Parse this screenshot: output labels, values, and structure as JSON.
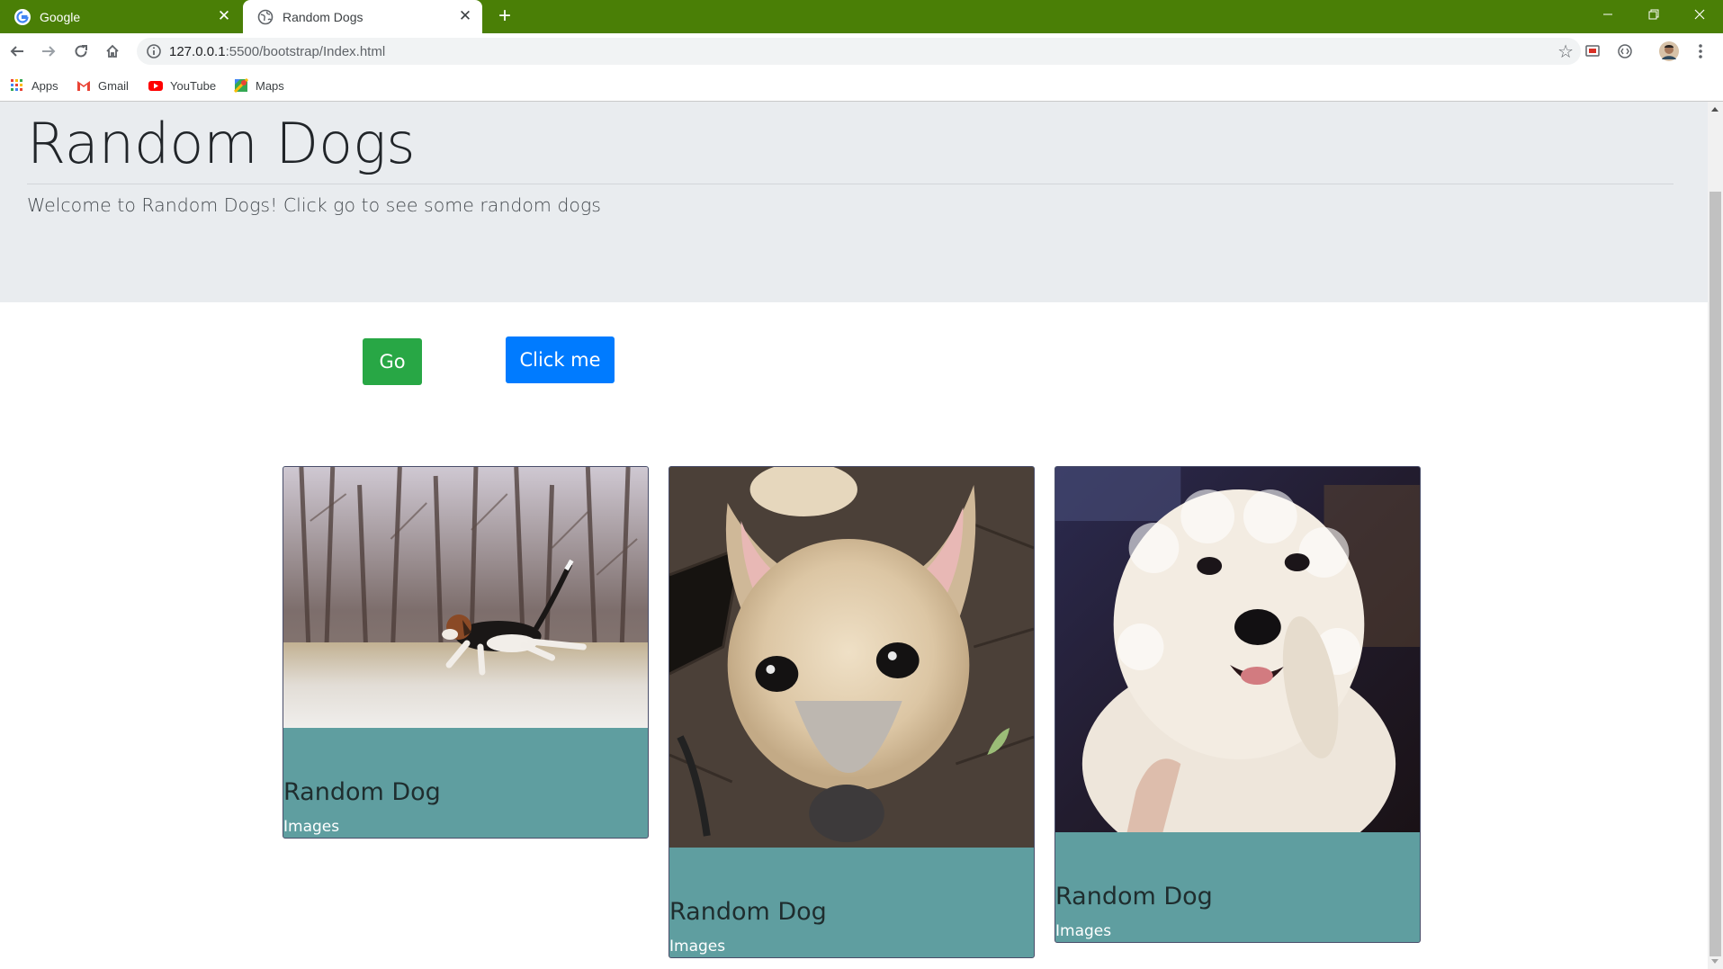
{
  "browser": {
    "tabs": [
      {
        "title": "Google",
        "favicon": "google-g-icon",
        "active": false
      },
      {
        "title": "Random Dogs",
        "favicon": "globe-icon",
        "active": true
      }
    ],
    "url_host": "127.0.0.1",
    "url_rest": ":5500/bootstrap/Index.html",
    "bookmarks": [
      {
        "label": "Apps",
        "icon": "apps-grid-icon"
      },
      {
        "label": "Gmail",
        "icon": "gmail-icon"
      },
      {
        "label": "YouTube",
        "icon": "youtube-icon"
      },
      {
        "label": "Maps",
        "icon": "maps-icon"
      }
    ],
    "colors": {
      "frame": "#4a7f06",
      "omnibox": "#f1f3f4"
    }
  },
  "page": {
    "title": "Random Dogs",
    "lead": "Welcome to Random Dogs! Click go to see some random dogs",
    "buttons": {
      "go": "Go",
      "click_me": "Click me"
    },
    "cards": [
      {
        "title": "Random Dog",
        "text": "Images",
        "image": "beagle running on snowy field"
      },
      {
        "title": "Random Dog",
        "text": "Images",
        "image": "cream shepherd mix face closeup"
      },
      {
        "title": "Random Dog",
        "text": "Images",
        "image": "white curly poodle smiling"
      }
    ],
    "colors": {
      "jumbotron": "#e9ecef",
      "go_button": "#28a745",
      "click_button": "#007bff",
      "card_body": "#5f9ea0"
    }
  }
}
